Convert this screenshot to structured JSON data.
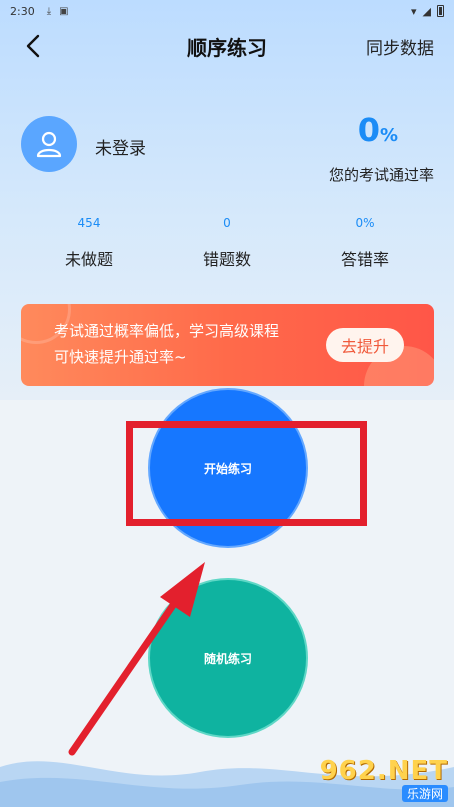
{
  "status_bar": {
    "time": "2:30",
    "download_icon": "download-icon",
    "app_icon": "app-icon"
  },
  "nav": {
    "title": "顺序练习",
    "sync_label": "同步数据",
    "back_icon": "chevron-left-icon"
  },
  "profile": {
    "avatar_icon": "user-icon",
    "login_status": "未登录"
  },
  "pass_rate": {
    "value": "0",
    "unit": "%",
    "label": "您的考试通过率"
  },
  "stats": [
    {
      "value": "454",
      "label": "未做题"
    },
    {
      "value": "0",
      "label": "错题数"
    },
    {
      "value": "0%",
      "label": "答错率"
    }
  ],
  "banner": {
    "line1": "考试通过概率偏低，学习高级课程",
    "line2": "可快速提升通过率~",
    "button_label": "去提升"
  },
  "practice": {
    "start_label": "开始练习",
    "random_label": "随机练习"
  },
  "watermark": {
    "main": "962.NET",
    "sub": "乐游网"
  },
  "colors": {
    "accent": "#1b8cf6",
    "start_circle": "#1677ff",
    "random_circle": "#0fb3a0",
    "banner": "#ff6a4a",
    "highlight": "#e3202d"
  }
}
